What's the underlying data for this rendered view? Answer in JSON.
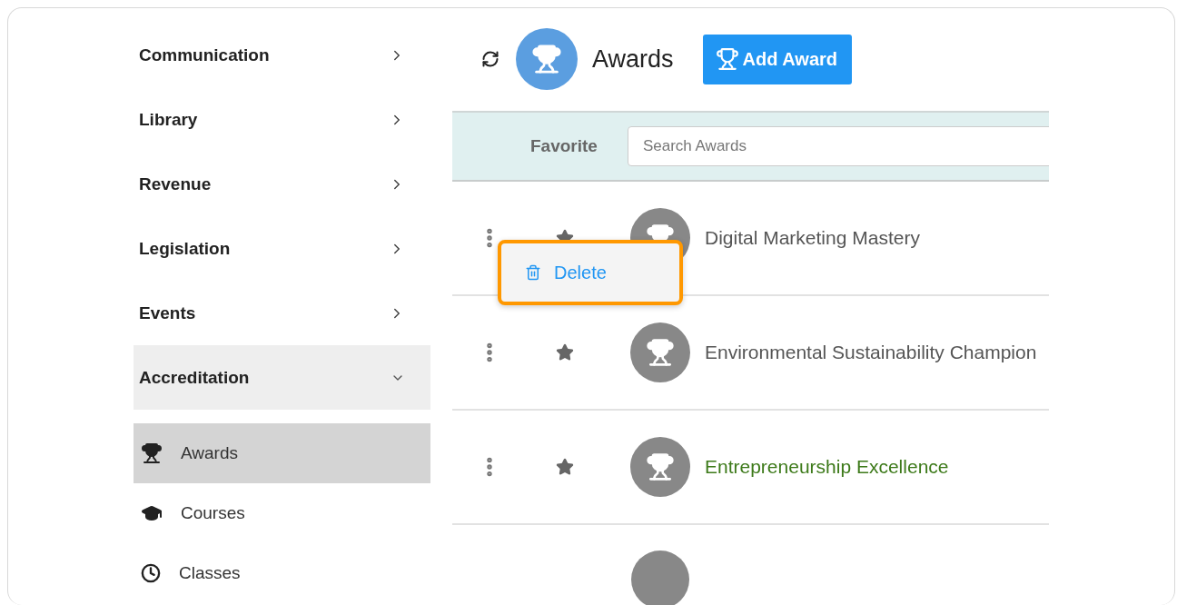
{
  "sidebar": {
    "items": [
      {
        "label": "Communication",
        "expanded": false
      },
      {
        "label": "Library",
        "expanded": false
      },
      {
        "label": "Revenue",
        "expanded": false
      },
      {
        "label": "Legislation",
        "expanded": false
      },
      {
        "label": "Events",
        "expanded": false
      },
      {
        "label": "Accreditation",
        "expanded": true,
        "children": [
          {
            "label": "Awards",
            "selected": true
          },
          {
            "label": "Courses",
            "selected": false
          },
          {
            "label": "Classes",
            "selected": false
          }
        ]
      }
    ]
  },
  "header": {
    "title": "Awards",
    "add_button": "Add Award"
  },
  "filter": {
    "favorite_label": "Favorite",
    "search": {
      "placeholder": "Search Awards"
    }
  },
  "rows": [
    {
      "name": "Digital Marketing Mastery",
      "highlighted": false,
      "menu": {
        "items": [
          "Delete"
        ]
      }
    },
    {
      "name": "Environmental Sustainability Champion",
      "highlighted": false
    },
    {
      "name": "Entrepreneurship Excellence",
      "highlighted": true
    },
    {}
  ]
}
